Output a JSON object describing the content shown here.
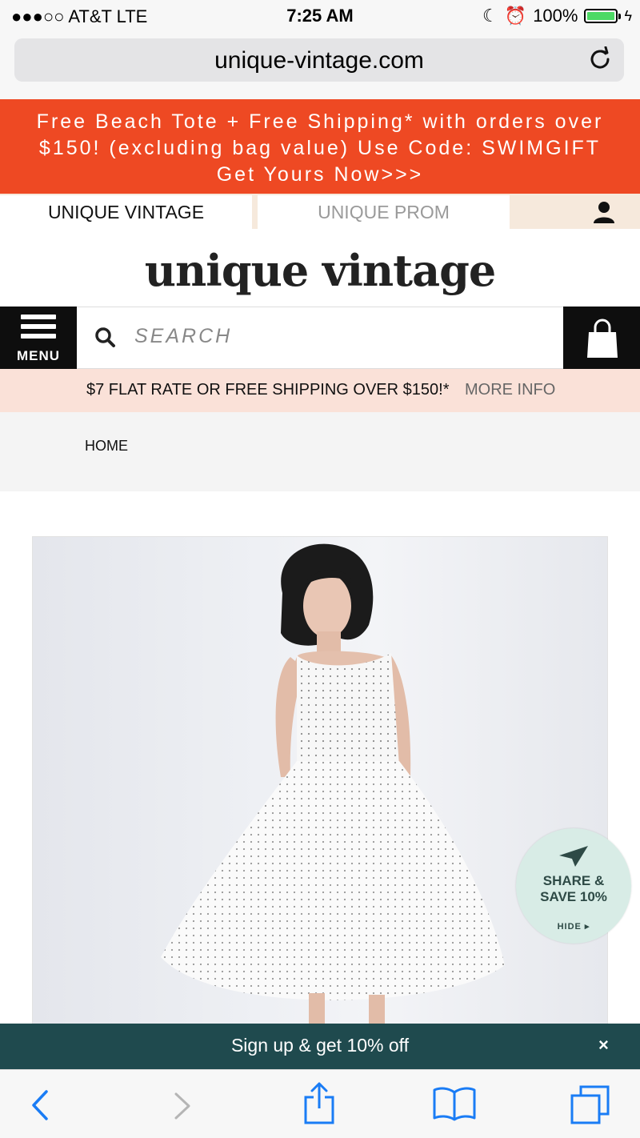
{
  "status_bar": {
    "carrier": "●●●○○ AT&T   LTE",
    "time": "7:25 AM",
    "battery": "100%"
  },
  "browser": {
    "url": "unique-vintage.com"
  },
  "promo": {
    "line1": "Free Beach Tote + Free Shipping* with orders over",
    "line2": "$150! (excluding bag value) Use Code: SWIMGIFT",
    "line3": "Get Yours Now>>>"
  },
  "tabs": [
    {
      "label": "UNIQUE VINTAGE"
    },
    {
      "label": "UNIQUE PROM"
    }
  ],
  "logo": {
    "text": "unique vintage"
  },
  "menu": {
    "label": "MENU"
  },
  "search": {
    "placeholder": "SEARCH"
  },
  "shipping": {
    "text": "$7 FLAT RATE OR FREE SHIPPING OVER $150!*",
    "more": "MORE INFO"
  },
  "breadcrumb": {
    "home": "HOME"
  },
  "share_widget": {
    "line1": "SHARE &",
    "line2": "SAVE 10%",
    "hide": "HIDE ▸"
  },
  "signup": {
    "text": "Sign up & get 10% off",
    "close": "×"
  },
  "colors": {
    "promo_bg": "#ee4923",
    "shipping_bg": "#fae1d8",
    "signup_bg": "#1f4a4e",
    "safari_blue": "#1a7cf5"
  }
}
